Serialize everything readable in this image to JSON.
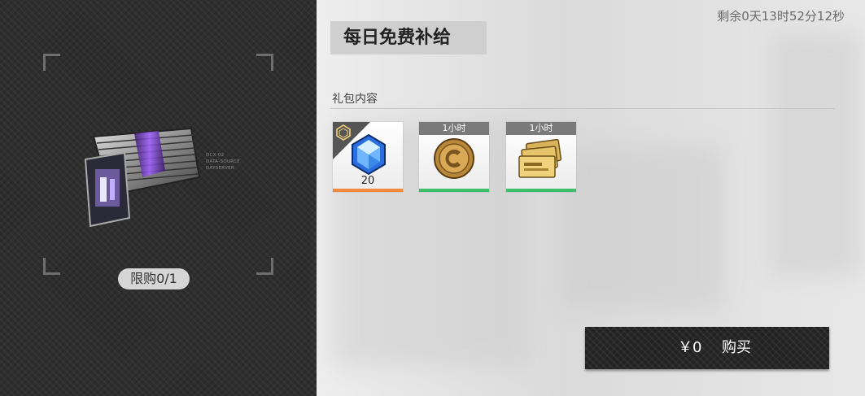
{
  "countdown": "剩余0天13时52分12秒",
  "title": "每日免费补给",
  "section_label": "礼包内容",
  "device_caption": [
    "DCX 02",
    "DATA-SOURCE",
    "DAYSERVER"
  ],
  "limit_badge": "限购0/1",
  "items": [
    {
      "name": "blue-crystal",
      "quantity": "20",
      "duration": "",
      "rarity_color": "#f08a3c"
    },
    {
      "name": "gold-coin",
      "quantity": "",
      "duration": "1小时",
      "rarity_color": "#3dbf6a"
    },
    {
      "name": "exp-cards",
      "quantity": "",
      "duration": "1小时",
      "rarity_color": "#3dbf6a"
    }
  ],
  "buy": {
    "price": "￥0",
    "label": "购买"
  },
  "colors": {
    "left_panel": "#2e2e2e",
    "button": "#222222",
    "orange_bar": "#f08a3c",
    "green_bar": "#3dbf6a"
  }
}
